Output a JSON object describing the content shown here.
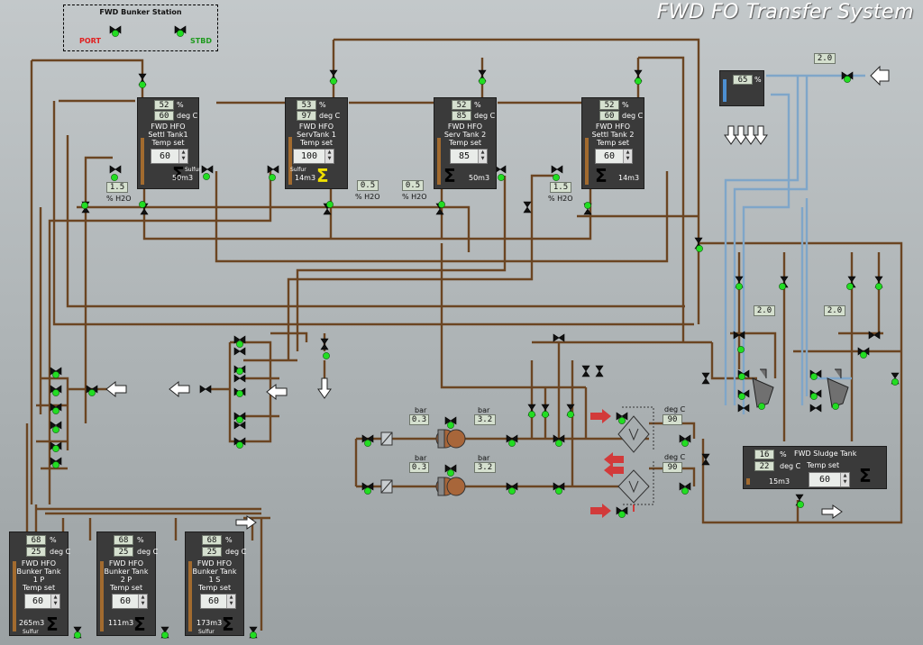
{
  "title": "FWD FO Transfer  System",
  "bunker_station": {
    "title": "FWD Bunker Station",
    "port": "PORT",
    "stbd": "STBD"
  },
  "tanks": [
    {
      "id": "settl-tank-1",
      "name": [
        "FWD HFO",
        "Settl Tank1"
      ],
      "level": "52",
      "temp": "60",
      "setpoint": "60",
      "volume": "50m3",
      "sulfur": "Sulfur",
      "heater_on": false,
      "level_frac": 0.52
    },
    {
      "id": "serv-tank-1",
      "name": [
        "FWD HFO",
        "ServTank 1"
      ],
      "level": "53",
      "temp": "97",
      "setpoint": "100",
      "volume": "14m3",
      "sulfur": "Sulfur",
      "heater_on": true,
      "level_frac": 0.53
    },
    {
      "id": "serv-tank-2",
      "name": [
        "FWD HFO",
        "Serv Tank 2"
      ],
      "level": "52",
      "temp": "85",
      "setpoint": "85",
      "volume": "50m3",
      "sulfur": "",
      "heater_on": false,
      "level_frac": 0.52
    },
    {
      "id": "settl-tank-2",
      "name": [
        "FWD HFO",
        "Settl Tank 2"
      ],
      "level": "52",
      "temp": "60",
      "setpoint": "60",
      "volume": "14m3",
      "sulfur": "",
      "heater_on": false,
      "level_frac": 0.52
    },
    {
      "id": "bunker-tank-1p",
      "name": [
        "FWD HFO",
        "Bunker Tank",
        "1 P"
      ],
      "level": "68",
      "temp": "25",
      "setpoint": "60",
      "volume": "265m3",
      "sulfur": "Sulfur",
      "heater_on": false,
      "level_frac": 0.68
    },
    {
      "id": "bunker-tank-2p",
      "name": [
        "FWD HFO",
        "Bunker Tank",
        "2 P"
      ],
      "level": "68",
      "temp": "25",
      "setpoint": "60",
      "volume": "111m3",
      "sulfur": "",
      "heater_on": false,
      "level_frac": 0.68
    },
    {
      "id": "bunker-tank-1s",
      "name": [
        "FWD HFO",
        "Bunker Tank",
        "1 S"
      ],
      "level": "68",
      "temp": "25",
      "setpoint": "60",
      "volume": "173m3",
      "sulfur": "Sulfur",
      "heater_on": false,
      "level_frac": 0.68
    }
  ],
  "sludge_tank": {
    "name": "FWD Sludge Tank",
    "level": "16",
    "temp": "22",
    "setpoint": "60",
    "volume": "15m3",
    "temp_set_label": "Temp set"
  },
  "water_tank": {
    "level": "65",
    "unit": "%"
  },
  "units": {
    "percent": "%",
    "degc": "deg C",
    "temp_set": "Temp set",
    "bar": "bar",
    "h2o": "% H2O"
  },
  "h2o_readings": {
    "settl1": "1.5",
    "serv1": "0.5",
    "serv2": "0.5",
    "settl2": "1.5"
  },
  "pumps": [
    {
      "inlet_bar": "0.3",
      "outlet_bar": "3.2"
    },
    {
      "inlet_bar": "0.3",
      "outlet_bar": "3.2"
    }
  ],
  "heaters_outlet_temp": [
    "90",
    "90"
  ],
  "flow_readings": {
    "fresh_water": "2.0",
    "purifier_1": "2.0",
    "purifier_2": "2.0"
  },
  "colors": {
    "pipe": "#6b4522",
    "water": "#7fa6c9",
    "valve_open": "#22dd22",
    "arrow_red": "#d23a3a"
  }
}
